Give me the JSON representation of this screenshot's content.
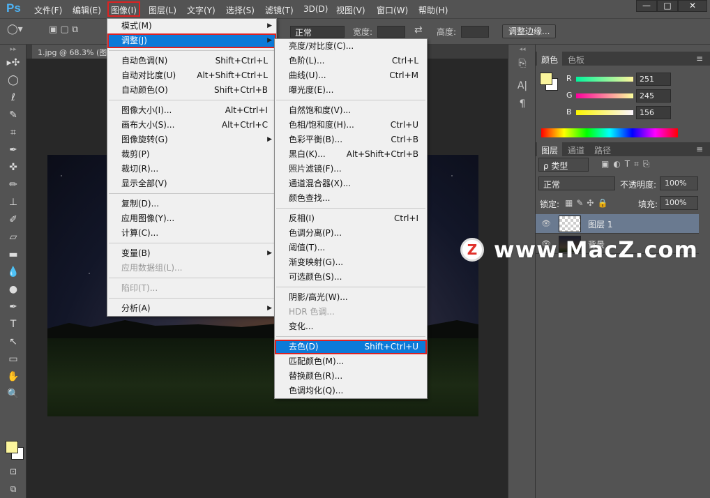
{
  "app": {
    "logo": "Ps"
  },
  "menubar": [
    "文件(F)",
    "编辑(E)",
    "图像(I)",
    "图层(L)",
    "文字(Y)",
    "选择(S)",
    "滤镜(T)",
    "3D(D)",
    "视图(V)",
    "窗口(W)",
    "帮助(H)"
  ],
  "window_controls": [
    "—",
    "□",
    "✕"
  ],
  "options": {
    "mode_value": "正常",
    "width_label": "宽度:",
    "height_label": "高度:",
    "refine_button": "调整边缘..."
  },
  "document_tab": "1.jpg @ 68.3% (图...",
  "image_menu": {
    "items": [
      {
        "label": "模式(M)",
        "submenu": true
      },
      {
        "label": "调整(J)",
        "submenu": true,
        "highlight": true
      },
      {
        "sep": true
      },
      {
        "label": "自动色调(N)",
        "shortcut": "Shift+Ctrl+L"
      },
      {
        "label": "自动对比度(U)",
        "shortcut": "Alt+Shift+Ctrl+L"
      },
      {
        "label": "自动颜色(O)",
        "shortcut": "Shift+Ctrl+B"
      },
      {
        "sep": true
      },
      {
        "label": "图像大小(I)...",
        "shortcut": "Alt+Ctrl+I"
      },
      {
        "label": "画布大小(S)...",
        "shortcut": "Alt+Ctrl+C"
      },
      {
        "label": "图像旋转(G)",
        "submenu": true
      },
      {
        "label": "裁剪(P)"
      },
      {
        "label": "裁切(R)..."
      },
      {
        "label": "显示全部(V)"
      },
      {
        "sep": true
      },
      {
        "label": "复制(D)..."
      },
      {
        "label": "应用图像(Y)..."
      },
      {
        "label": "计算(C)..."
      },
      {
        "sep": true
      },
      {
        "label": "变量(B)",
        "submenu": true
      },
      {
        "label": "应用数据组(L)...",
        "disabled": true
      },
      {
        "sep": true
      },
      {
        "label": "陷印(T)...",
        "disabled": true
      },
      {
        "sep": true
      },
      {
        "label": "分析(A)",
        "submenu": true
      }
    ]
  },
  "adjust_menu": {
    "items": [
      {
        "label": "亮度/对比度(C)..."
      },
      {
        "label": "色阶(L)...",
        "shortcut": "Ctrl+L"
      },
      {
        "label": "曲线(U)...",
        "shortcut": "Ctrl+M"
      },
      {
        "label": "曝光度(E)..."
      },
      {
        "sep": true
      },
      {
        "label": "自然饱和度(V)..."
      },
      {
        "label": "色相/饱和度(H)...",
        "shortcut": "Ctrl+U"
      },
      {
        "label": "色彩平衡(B)...",
        "shortcut": "Ctrl+B"
      },
      {
        "label": "黑白(K)...",
        "shortcut": "Alt+Shift+Ctrl+B"
      },
      {
        "label": "照片滤镜(F)..."
      },
      {
        "label": "通道混合器(X)..."
      },
      {
        "label": "颜色查找..."
      },
      {
        "sep": true
      },
      {
        "label": "反相(I)",
        "shortcut": "Ctrl+I"
      },
      {
        "label": "色调分离(P)..."
      },
      {
        "label": "阈值(T)..."
      },
      {
        "label": "渐变映射(G)..."
      },
      {
        "label": "可选颜色(S)..."
      },
      {
        "sep": true
      },
      {
        "label": "阴影/高光(W)..."
      },
      {
        "label": "HDR 色调...",
        "disabled": true
      },
      {
        "label": "变化..."
      },
      {
        "sep": true
      },
      {
        "label": "去色(D)",
        "shortcut": "Shift+Ctrl+U",
        "highlight": true
      },
      {
        "label": "匹配颜色(M)..."
      },
      {
        "label": "替换颜色(R)..."
      },
      {
        "label": "色调均化(Q)..."
      }
    ]
  },
  "color_panel": {
    "tabs": [
      "颜色",
      "色板"
    ],
    "channels": [
      {
        "label": "R",
        "value": "251"
      },
      {
        "label": "G",
        "value": "245"
      },
      {
        "label": "B",
        "value": "156"
      }
    ],
    "fg_color": "#fbf59c"
  },
  "layers_panel": {
    "tabs": [
      "图层",
      "通道",
      "路径"
    ],
    "filter": "ρ 类型",
    "blend": "正常",
    "opacity_label": "不透明度:",
    "opacity": "100%",
    "lock_label": "锁定:",
    "fill_label": "填充:",
    "fill": "100%",
    "layers": [
      {
        "name": "图层 1",
        "selected": true
      },
      {
        "name": "背景"
      }
    ]
  },
  "watermark": {
    "logo": "Z",
    "text": "www.MacZ.com"
  }
}
